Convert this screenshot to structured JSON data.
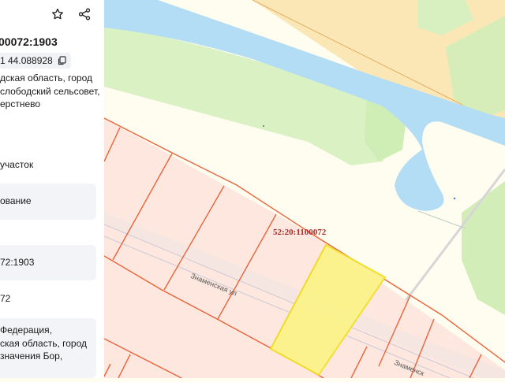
{
  "panel": {
    "cadastral_number": "00072:1903",
    "coordinates": "1 44.088928",
    "address_lines": [
      "дская область, город",
      "слободский сельсовет,",
      "ерстнево"
    ],
    "category": "участок",
    "usage": "ование",
    "number_ref": "72:1903",
    "quarter_ref": "72",
    "address_full_lines": [
      "Федерация,",
      "ская область, город",
      "значения Бор,"
    ]
  },
  "map": {
    "quarter_label": "52:20:1100072",
    "street_label": "Знаменская ул",
    "street_label_2": "Знаменск",
    "colors": {
      "background": "#fffdf0",
      "river": "#b3dcf5",
      "parcel_fill": "#fde7de",
      "parcel_border": "#e8643a",
      "selected_fill": "#fbf38a",
      "selected_border": "#f2e028",
      "vegetation": "#cfeeb5",
      "zone": "#fbe7b5"
    }
  }
}
